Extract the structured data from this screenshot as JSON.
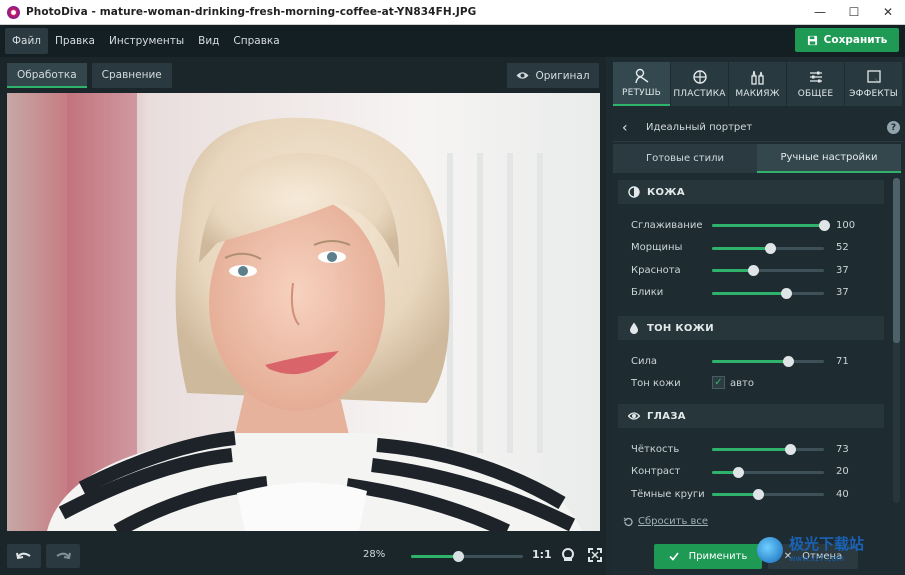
{
  "window": {
    "title": "PhotoDiva - mature-woman-drinking-fresh-morning-coffee-at-YN834FH.JPG"
  },
  "menu": {
    "items": [
      "Файл",
      "Правка",
      "Инструменты",
      "Вид",
      "Справка"
    ]
  },
  "toolbar": {
    "save_label": "Сохранить"
  },
  "mode_tabs": {
    "items": [
      "Обработка",
      "Сравнение"
    ],
    "original_label": "Оригинал"
  },
  "zoom": {
    "percent_label": "28%",
    "level": 0.42,
    "one_to_one": "1:1"
  },
  "tool_tabs": [
    "РЕТУШЬ",
    "ПЛАСТИКА",
    "МАКИЯЖ",
    "ОБЩЕЕ",
    "ЭФФЕКТЫ"
  ],
  "panel": {
    "section_title": "Идеальный портрет",
    "help": "?",
    "sub_tabs": [
      "Готовые стили",
      "Ручные настройки"
    ]
  },
  "groups": {
    "skin": {
      "title": "КОЖА",
      "sliders": [
        {
          "label": "Сглаживание",
          "value": "100",
          "level": 1.0
        },
        {
          "label": "Морщины",
          "value": "52",
          "level": 0.52
        },
        {
          "label": "Краснота",
          "value": "37",
          "level": 0.37
        },
        {
          "label": "Блики",
          "value": "37",
          "level": 0.66
        }
      ]
    },
    "skin_tone": {
      "title": "ТОН КОЖИ",
      "sliders": [
        {
          "label": "Сила",
          "value": "71",
          "level": 0.68
        }
      ],
      "check": {
        "label": "Тон кожи",
        "value_label": "авто",
        "checked": true
      }
    },
    "eyes": {
      "title": "ГЛАЗА",
      "sliders": [
        {
          "label": "Чёткость",
          "value": "73",
          "level": 0.7
        },
        {
          "label": "Контраст",
          "value": "20",
          "level": 0.23
        },
        {
          "label": "Тёмные круги",
          "value": "40",
          "level": 0.41
        }
      ]
    }
  },
  "actions": {
    "reset_label": "Сбросить все",
    "apply_label": "Применить",
    "cancel_label": "Отмена"
  },
  "watermark": {
    "text": "极光下载站",
    "sub": "www.xz7.com"
  },
  "colors": {
    "accent": "#2fb36b",
    "save": "#1f9a55",
    "panel": "#1e2b30",
    "menubar": "#141f23"
  }
}
